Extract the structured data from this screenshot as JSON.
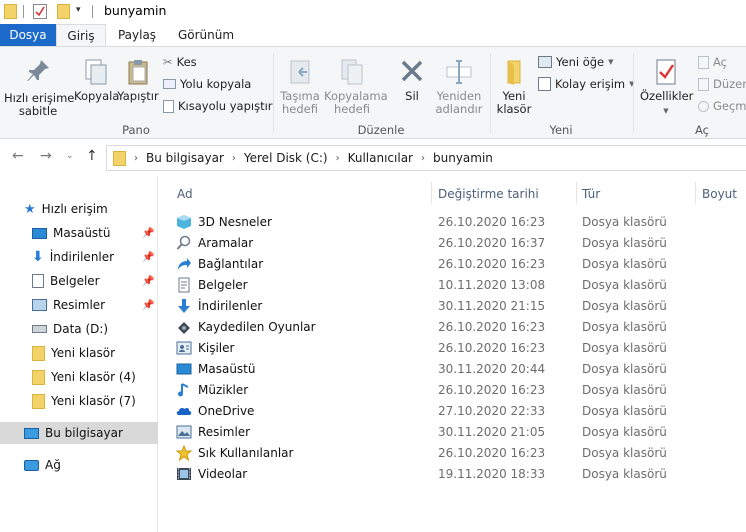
{
  "window": {
    "title": "bunyamin"
  },
  "tabs": [
    "Dosya",
    "Giriş",
    "Paylaş",
    "Görünüm"
  ],
  "ribbon": {
    "pin_quick_access": "Hızlı erişime\nsabitle",
    "copy": "Kopyala",
    "paste": "Yapıştır",
    "cut": "Kes",
    "copy_path": "Yolu kopyala",
    "paste_shortcut": "Kısayolu yapıştır",
    "move_to": "Taşıma\nhedefi",
    "copy_to": "Kopyalama\nhedefi",
    "delete": "Sil",
    "rename": "Yeniden\nadlandır",
    "new_folder": "Yeni\nklasör",
    "new_item": "Yeni öğe",
    "easy_access": "Kolay erişim",
    "properties": "Özellikler",
    "open": "Aç",
    "edit": "Düzen",
    "history": "Geçmi",
    "group_clipboard": "Pano",
    "group_organize": "Düzenle",
    "group_new": "Yeni",
    "group_open": "Aç"
  },
  "address": {
    "segments": [
      "Bu bilgisayar",
      "Yerel Disk (C:)",
      "Kullanıcılar",
      "bunyamin"
    ]
  },
  "nav": {
    "quick_access": "Hızlı erişim",
    "items": [
      {
        "label": "Masaüstü",
        "icon": "desktop-icon",
        "pinned": true
      },
      {
        "label": "İndirilenler",
        "icon": "downloads-icon",
        "pinned": true
      },
      {
        "label": "Belgeler",
        "icon": "documents-icon",
        "pinned": true
      },
      {
        "label": "Resimler",
        "icon": "pictures-icon",
        "pinned": true
      },
      {
        "label": "Data (D:)",
        "icon": "drive-icon",
        "pinned": false
      },
      {
        "label": "Yeni klasör",
        "icon": "folder-icon",
        "pinned": false
      },
      {
        "label": "Yeni klasör (4)",
        "icon": "folder-icon",
        "pinned": false
      },
      {
        "label": "Yeni klasör (7)",
        "icon": "folder-icon",
        "pinned": false
      }
    ],
    "this_pc": "Bu bilgisayar",
    "network": "Ağ"
  },
  "columns": {
    "name": "Ad",
    "date": "Değiştirme tarihi",
    "type": "Tür",
    "size": "Boyut"
  },
  "files": [
    {
      "name": "3D Nesneler",
      "date": "26.10.2020 16:23",
      "type": "Dosya klasörü",
      "icon": "3d-objects-icon"
    },
    {
      "name": "Aramalar",
      "date": "26.10.2020 16:37",
      "type": "Dosya klasörü",
      "icon": "searches-icon"
    },
    {
      "name": "Bağlantılar",
      "date": "26.10.2020 16:23",
      "type": "Dosya klasörü",
      "icon": "links-icon"
    },
    {
      "name": "Belgeler",
      "date": "10.11.2020 13:08",
      "type": "Dosya klasörü",
      "icon": "documents-icon"
    },
    {
      "name": "İndirilenler",
      "date": "30.11.2020 21:15",
      "type": "Dosya klasörü",
      "icon": "downloads-icon"
    },
    {
      "name": "Kaydedilen Oyunlar",
      "date": "26.10.2020 16:23",
      "type": "Dosya klasörü",
      "icon": "saved-games-icon"
    },
    {
      "name": "Kişiler",
      "date": "26.10.2020 16:23",
      "type": "Dosya klasörü",
      "icon": "contacts-icon"
    },
    {
      "name": "Masaüstü",
      "date": "30.11.2020 20:44",
      "type": "Dosya klasörü",
      "icon": "desktop-icon"
    },
    {
      "name": "Müzikler",
      "date": "26.10.2020 16:23",
      "type": "Dosya klasörü",
      "icon": "music-icon"
    },
    {
      "name": "OneDrive",
      "date": "27.10.2020 22:33",
      "type": "Dosya klasörü",
      "icon": "onedrive-icon"
    },
    {
      "name": "Resimler",
      "date": "30.11.2020 21:05",
      "type": "Dosya klasörü",
      "icon": "pictures-icon"
    },
    {
      "name": "Sık Kullanılanlar",
      "date": "26.10.2020 16:23",
      "type": "Dosya klasörü",
      "icon": "favorites-icon"
    },
    {
      "name": "Videolar",
      "date": "19.11.2020 18:33",
      "type": "Dosya klasörü",
      "icon": "videos-icon"
    }
  ]
}
